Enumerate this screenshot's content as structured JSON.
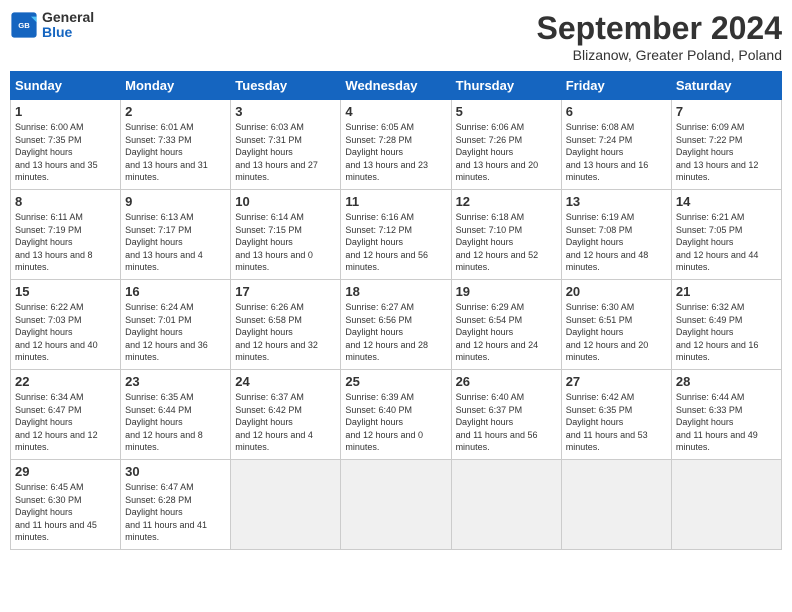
{
  "header": {
    "logo_general": "General",
    "logo_blue": "Blue",
    "month_year": "September 2024",
    "location": "Blizanow, Greater Poland, Poland"
  },
  "days_of_week": [
    "Sunday",
    "Monday",
    "Tuesday",
    "Wednesday",
    "Thursday",
    "Friday",
    "Saturday"
  ],
  "weeks": [
    [
      {
        "num": "1",
        "sr": "6:00 AM",
        "ss": "7:35 PM",
        "dl": "13 hours and 35 minutes."
      },
      {
        "num": "2",
        "sr": "6:01 AM",
        "ss": "7:33 PM",
        "dl": "13 hours and 31 minutes."
      },
      {
        "num": "3",
        "sr": "6:03 AM",
        "ss": "7:31 PM",
        "dl": "13 hours and 27 minutes."
      },
      {
        "num": "4",
        "sr": "6:05 AM",
        "ss": "7:28 PM",
        "dl": "13 hours and 23 minutes."
      },
      {
        "num": "5",
        "sr": "6:06 AM",
        "ss": "7:26 PM",
        "dl": "13 hours and 20 minutes."
      },
      {
        "num": "6",
        "sr": "6:08 AM",
        "ss": "7:24 PM",
        "dl": "13 hours and 16 minutes."
      },
      {
        "num": "7",
        "sr": "6:09 AM",
        "ss": "7:22 PM",
        "dl": "13 hours and 12 minutes."
      }
    ],
    [
      {
        "num": "8",
        "sr": "6:11 AM",
        "ss": "7:19 PM",
        "dl": "13 hours and 8 minutes."
      },
      {
        "num": "9",
        "sr": "6:13 AM",
        "ss": "7:17 PM",
        "dl": "13 hours and 4 minutes."
      },
      {
        "num": "10",
        "sr": "6:14 AM",
        "ss": "7:15 PM",
        "dl": "13 hours and 0 minutes."
      },
      {
        "num": "11",
        "sr": "6:16 AM",
        "ss": "7:12 PM",
        "dl": "12 hours and 56 minutes."
      },
      {
        "num": "12",
        "sr": "6:18 AM",
        "ss": "7:10 PM",
        "dl": "12 hours and 52 minutes."
      },
      {
        "num": "13",
        "sr": "6:19 AM",
        "ss": "7:08 PM",
        "dl": "12 hours and 48 minutes."
      },
      {
        "num": "14",
        "sr": "6:21 AM",
        "ss": "7:05 PM",
        "dl": "12 hours and 44 minutes."
      }
    ],
    [
      {
        "num": "15",
        "sr": "6:22 AM",
        "ss": "7:03 PM",
        "dl": "12 hours and 40 minutes."
      },
      {
        "num": "16",
        "sr": "6:24 AM",
        "ss": "7:01 PM",
        "dl": "12 hours and 36 minutes."
      },
      {
        "num": "17",
        "sr": "6:26 AM",
        "ss": "6:58 PM",
        "dl": "12 hours and 32 minutes."
      },
      {
        "num": "18",
        "sr": "6:27 AM",
        "ss": "6:56 PM",
        "dl": "12 hours and 28 minutes."
      },
      {
        "num": "19",
        "sr": "6:29 AM",
        "ss": "6:54 PM",
        "dl": "12 hours and 24 minutes."
      },
      {
        "num": "20",
        "sr": "6:30 AM",
        "ss": "6:51 PM",
        "dl": "12 hours and 20 minutes."
      },
      {
        "num": "21",
        "sr": "6:32 AM",
        "ss": "6:49 PM",
        "dl": "12 hours and 16 minutes."
      }
    ],
    [
      {
        "num": "22",
        "sr": "6:34 AM",
        "ss": "6:47 PM",
        "dl": "12 hours and 12 minutes."
      },
      {
        "num": "23",
        "sr": "6:35 AM",
        "ss": "6:44 PM",
        "dl": "12 hours and 8 minutes."
      },
      {
        "num": "24",
        "sr": "6:37 AM",
        "ss": "6:42 PM",
        "dl": "12 hours and 4 minutes."
      },
      {
        "num": "25",
        "sr": "6:39 AM",
        "ss": "6:40 PM",
        "dl": "12 hours and 0 minutes."
      },
      {
        "num": "26",
        "sr": "6:40 AM",
        "ss": "6:37 PM",
        "dl": "11 hours and 56 minutes."
      },
      {
        "num": "27",
        "sr": "6:42 AM",
        "ss": "6:35 PM",
        "dl": "11 hours and 53 minutes."
      },
      {
        "num": "28",
        "sr": "6:44 AM",
        "ss": "6:33 PM",
        "dl": "11 hours and 49 minutes."
      }
    ],
    [
      {
        "num": "29",
        "sr": "6:45 AM",
        "ss": "6:30 PM",
        "dl": "11 hours and 45 minutes."
      },
      {
        "num": "30",
        "sr": "6:47 AM",
        "ss": "6:28 PM",
        "dl": "11 hours and 41 minutes."
      },
      null,
      null,
      null,
      null,
      null
    ]
  ]
}
